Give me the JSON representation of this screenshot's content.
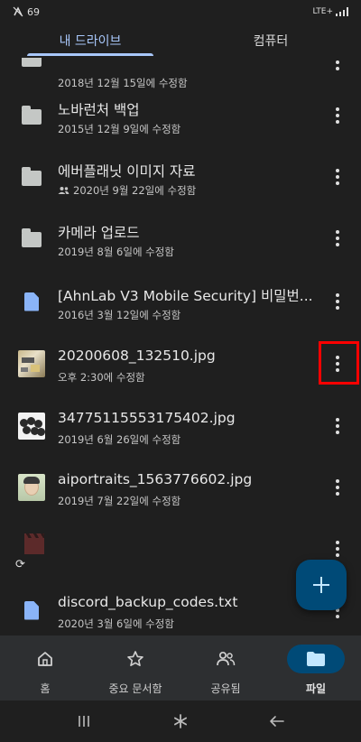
{
  "status": {
    "left_text": "69",
    "network": "LTE+"
  },
  "tabs": [
    {
      "label": "내 드라이브",
      "active": true
    },
    {
      "label": "컴퓨터",
      "active": false
    }
  ],
  "files": [
    {
      "title": "",
      "subtitle": "2018년 12월 15일에 수정함",
      "icon": "folder-icon",
      "shared": false
    },
    {
      "title": "노바런처 백업",
      "subtitle": "2015년 12월 9일에 수정함",
      "icon": "folder-icon",
      "shared": false
    },
    {
      "title": "에버플래닛 이미지 자료",
      "subtitle": "2020년 9월 22일에 수정함",
      "icon": "folder-icon",
      "shared": true
    },
    {
      "title": "카메라 업로드",
      "subtitle": "2019년 8월 6일에 수정함",
      "icon": "folder-icon",
      "shared": false
    },
    {
      "title": "[AhnLab V3 Mobile Security] 비밀번...",
      "subtitle": "2016년 3월 12일에 수정함",
      "icon": "doc-icon",
      "shared": false
    },
    {
      "title": "20200608_132510.jpg",
      "subtitle": "오후 2:30에 수정함",
      "icon": "image-thumbnail",
      "shared": false
    },
    {
      "title": "34775115553175402.jpg",
      "subtitle": "2019년 6월 26일에 수정함",
      "icon": "image-thumbnail",
      "shared": false
    },
    {
      "title": "aiportraits_1563776602.jpg",
      "subtitle": "2019년 7월 22일에 수정함",
      "icon": "image-thumbnail",
      "shared": false
    },
    {
      "title": "",
      "subtitle": "",
      "icon": "video-icon",
      "shared": false
    },
    {
      "title": "discord_backup_codes.txt",
      "subtitle": "2020년 3월 6일에 수정함",
      "icon": "text-file-icon",
      "shared": false
    }
  ],
  "fab": {
    "icon": "plus-icon"
  },
  "bottom_nav": [
    {
      "label": "홈",
      "icon": "home-icon",
      "active": false
    },
    {
      "label": "중요 문서함",
      "icon": "star-icon",
      "active": false
    },
    {
      "label": "공유됨",
      "icon": "people-icon",
      "active": false
    },
    {
      "label": "파일",
      "icon": "folder-icon",
      "active": true
    }
  ],
  "colors": {
    "accent": "#a8c7fa",
    "fab_bg": "#004a77",
    "background": "#1f1f1f",
    "highlight": "#ff0000"
  }
}
